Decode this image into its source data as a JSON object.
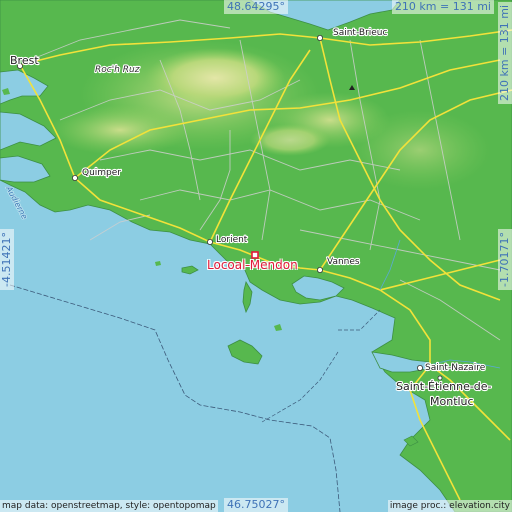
{
  "map": {
    "title_place": "Locoal-Mendon",
    "colors": {
      "sea": "#8ccde3",
      "land_low": "#47b04a",
      "land_mid": "#8ccf60",
      "land_high": "#d7e29a",
      "roads": "#f2e23a",
      "minor_roads": "#cfcfcf",
      "marker": "#e31a3a",
      "coord_text": "#3f73b7"
    },
    "coords": {
      "top_lat": "48.64295°",
      "bottom_lat": "46.75027°",
      "left_lon": "-4.51421°",
      "right_lon": "-1.70171°"
    },
    "scale": {
      "horizontal": "210 km = 131 mi",
      "vertical": "210 km = 131 mi"
    },
    "places": {
      "brest": "Brest",
      "saint_brieuc": "Saint-Brieuc",
      "roc_h_ruz": "Roc'h Ruz",
      "quimper": "Quimper",
      "lorient": "Lorient",
      "vannes": "Vannes",
      "saint_nazaire": "Saint-Nazaire",
      "saint_etienne_1": "Saint-Étienne-de-",
      "saint_etienne_2": "Montluc",
      "audierne": "Audierne"
    },
    "credits": {
      "left": "map data: openstreetmap, style: opentopomap",
      "right": "image proc.: elevation.city"
    },
    "icons": {
      "marker": "square-marker-icon",
      "city": "city-dot-icon",
      "peak": "peak-triangle-icon"
    }
  }
}
